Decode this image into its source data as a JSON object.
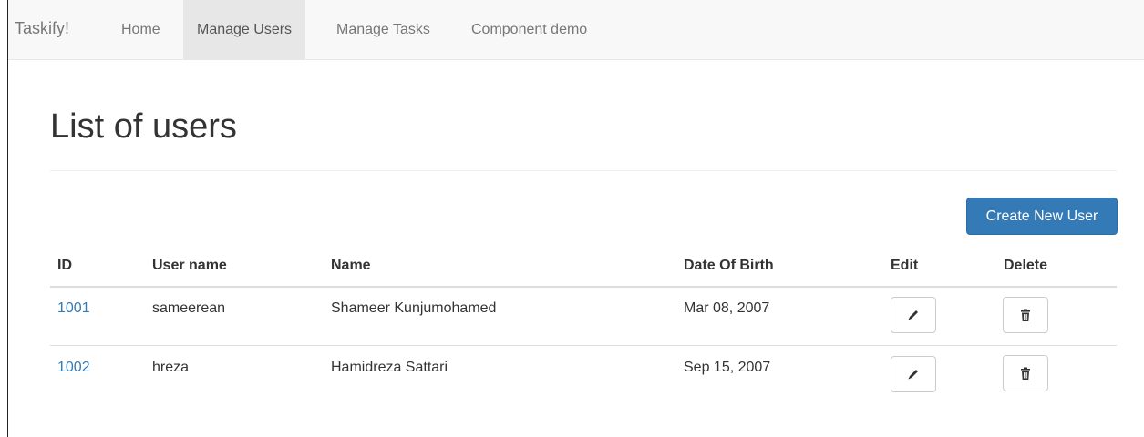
{
  "navbar": {
    "brand": "Taskify!",
    "items": [
      {
        "label": "Home",
        "active": false
      },
      {
        "label": "Manage Users",
        "active": true
      },
      {
        "label": "Manage Tasks",
        "active": false
      },
      {
        "label": "Component demo",
        "active": false
      }
    ]
  },
  "page": {
    "title": "List of users",
    "create_button_label": "Create New User"
  },
  "table": {
    "columns": [
      "ID",
      "User name",
      "Name",
      "Date Of Birth",
      "Edit",
      "Delete"
    ],
    "rows": [
      {
        "id": "1001",
        "username": "sameerean",
        "name": "Shameer Kunjumohamed",
        "dob": "Mar 08, 2007",
        "edit_icon": "pencil-icon",
        "delete_icon": "trash-icon"
      },
      {
        "id": "1002",
        "username": "hreza",
        "name": "Hamidreza Sattari",
        "dob": "Sep 15, 2007",
        "edit_icon": "pencil-icon",
        "delete_icon": "trash-icon"
      }
    ]
  },
  "colors": {
    "primary": "#337ab7",
    "navbar_bg": "#f8f8f8",
    "nav_active_bg": "#e7e7e7"
  }
}
